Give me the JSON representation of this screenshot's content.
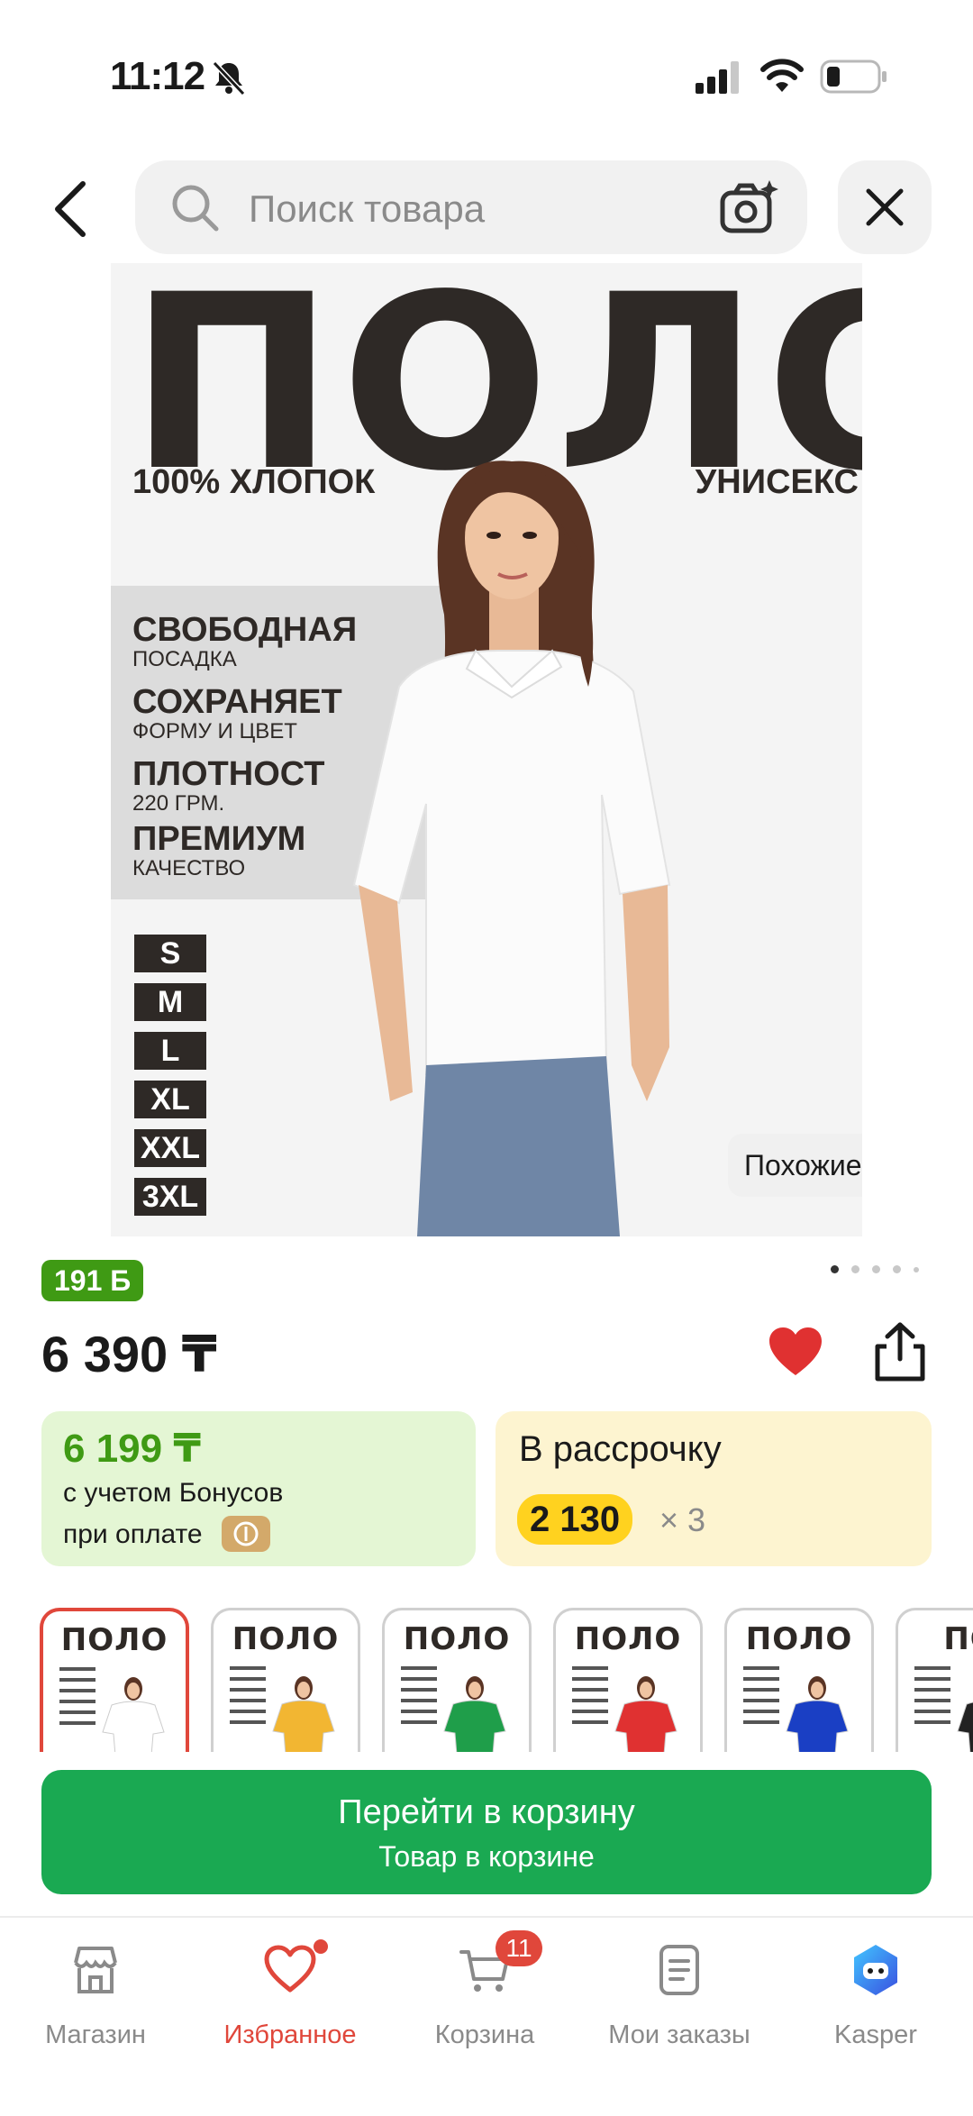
{
  "status_bar": {
    "time": "11:12"
  },
  "search": {
    "placeholder": "Поиск товара"
  },
  "product_image": {
    "title": "ПОЛО",
    "subtitle_left": "100% ХЛОПОК",
    "subtitle_right": "УНИСЕКС",
    "features": [
      {
        "title": "СВОБОДНАЯ",
        "sub": "ПОСАДКА"
      },
      {
        "title": "СОХРАНЯЕТ",
        "sub": "ФОРМУ И ЦВЕТ"
      },
      {
        "title": "ПЛОТНОСТ",
        "sub": "220 ГРМ."
      },
      {
        "title": "ПРЕМИУМ",
        "sub": "КАЧЕСТВО"
      }
    ],
    "sizes": [
      "S",
      "M",
      "L",
      "XL",
      "XXL",
      "3XL"
    ],
    "similar_label": "Похожие",
    "carousel_index": 1,
    "carousel_total": 5
  },
  "bonus_badge": "191 Б",
  "price": "6 390 ₸",
  "favorite": true,
  "bonus_card": {
    "price": "6 199 ₸",
    "line1": "с учетом Бонусов",
    "line2": "при оплате"
  },
  "installment_card": {
    "title": "В рассрочку",
    "amount": "2 130",
    "times": "× 3"
  },
  "variants": [
    {
      "title": "ПОЛО",
      "color": "#ffffff",
      "selected": true
    },
    {
      "title": "ПОЛО",
      "color": "#f2b632",
      "selected": false
    },
    {
      "title": "ПОЛО",
      "color": "#1f9e4a",
      "selected": false
    },
    {
      "title": "ПОЛО",
      "color": "#e03131",
      "selected": false
    },
    {
      "title": "ПОЛО",
      "color": "#1a3fc4",
      "selected": false
    },
    {
      "title": "ПО",
      "color": "#222222",
      "selected": false
    }
  ],
  "cta": {
    "main": "Перейти в корзину",
    "sub": "Товар в корзине"
  },
  "bottom_nav": {
    "items": [
      {
        "label": "Магазин",
        "icon": "store-icon"
      },
      {
        "label": "Избранное",
        "icon": "heart-icon"
      },
      {
        "label": "Корзина",
        "icon": "cart-icon"
      },
      {
        "label": "Мои заказы",
        "icon": "orders-icon"
      },
      {
        "label": "Kasper",
        "icon": "kasper-icon"
      }
    ],
    "active_index": 1,
    "cart_count": "11"
  },
  "colors": {
    "accent_green": "#1aa952",
    "bonus_green": "#3f9a14",
    "accent_red": "#e0473b",
    "installment_yellow": "#ffd21f"
  }
}
